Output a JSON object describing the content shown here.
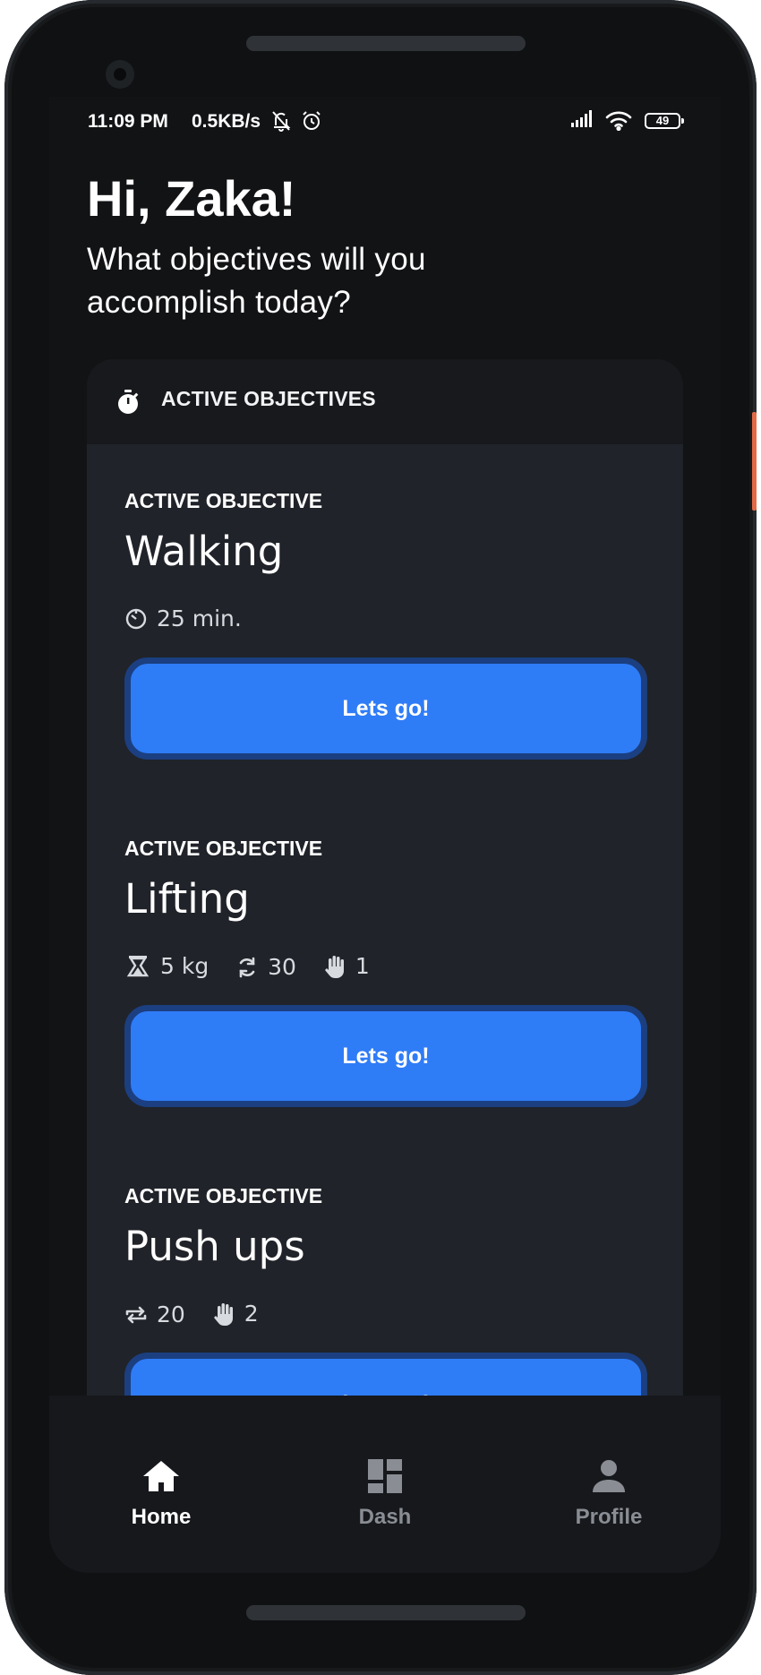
{
  "status_bar": {
    "time": "11:09 PM",
    "net_speed": "0.5KB/s",
    "battery": "49",
    "icons": [
      "bell-off-icon",
      "alarm-icon",
      "signal-icon",
      "wifi-icon",
      "battery-icon"
    ]
  },
  "greeting": {
    "title": "Hi, Zaka!",
    "subtitle": "What objectives will you accomplish today?"
  },
  "objectives_panel": {
    "header": "ACTIVE OBJECTIVES",
    "header_icon": "stopwatch-icon",
    "objectives": [
      {
        "label": "ACTIVE OBJECTIVE",
        "title": "Walking",
        "meta": [
          {
            "icon": "timer-icon",
            "value": "25 min."
          }
        ],
        "button": "Lets go!"
      },
      {
        "label": "ACTIVE OBJECTIVE",
        "title": "Lifting",
        "meta": [
          {
            "icon": "weight-icon",
            "value": "5 kg"
          },
          {
            "icon": "refresh-icon",
            "value": "30"
          },
          {
            "icon": "hand-icon",
            "value": "1"
          }
        ],
        "button": "Lets go!"
      },
      {
        "label": "ACTIVE OBJECTIVE",
        "title": "Push ups",
        "meta": [
          {
            "icon": "repeat-icon",
            "value": "20"
          },
          {
            "icon": "hand-icon",
            "value": "2"
          }
        ],
        "button": "Lets go!"
      }
    ]
  },
  "bottom_nav": [
    {
      "label": "Home",
      "icon": "home-icon",
      "active": true
    },
    {
      "label": "Dash",
      "icon": "dashboard-icon",
      "active": false
    },
    {
      "label": "Profile",
      "icon": "person-icon",
      "active": false
    }
  ],
  "colors": {
    "background": "#121315",
    "panel": "#202329",
    "panel_header": "#17191c",
    "accent": "#2f7cf7",
    "accent_border": "#1b3f80",
    "nav_active": "#ffffff",
    "nav_inactive": "#8a8e94"
  }
}
